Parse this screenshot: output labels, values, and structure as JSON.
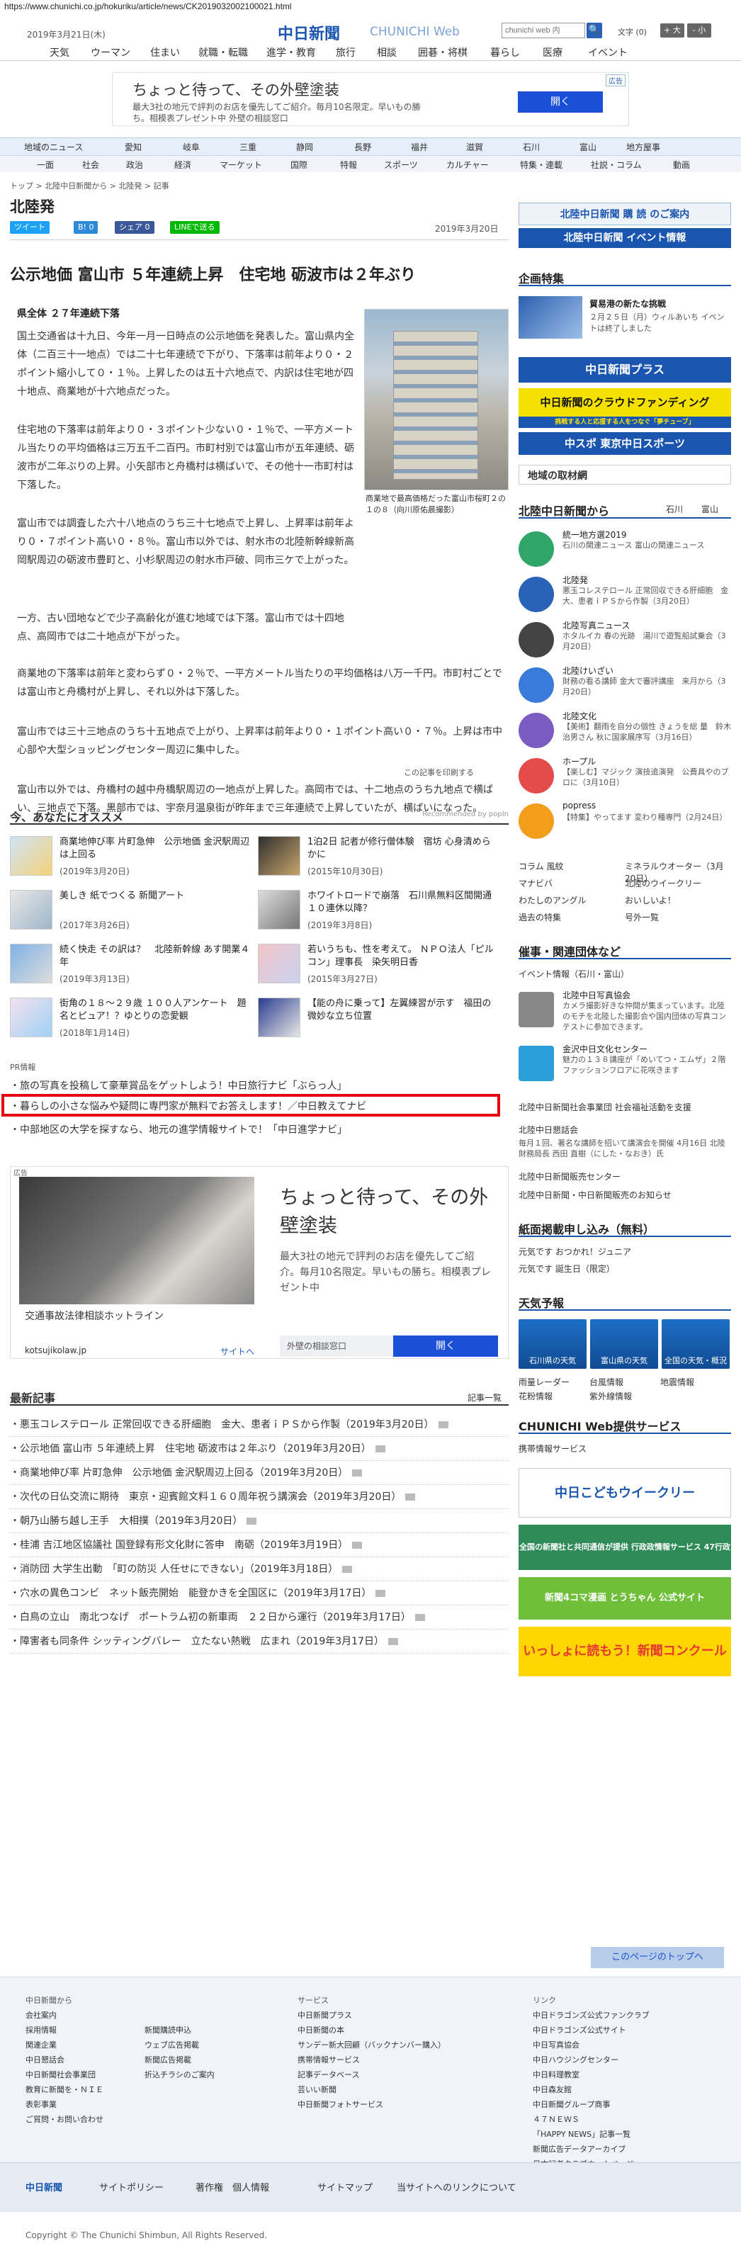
{
  "browser": {
    "url": "https://www.chunichi.co.jp/hokuriku/article/news/CK2019032002100021.html"
  },
  "header": {
    "date": "2019年3月21日(木)",
    "logo": "中日新聞",
    "logo_sub": "CHUNICHI Web",
    "search_placeholder": "chunichi web 内",
    "search_icon": "🔍",
    "font_label": "文字",
    "font_size": "(0)",
    "font_up": "+ 大",
    "font_down": "- 小"
  },
  "topnav": [
    "天気",
    "ウーマン",
    "住まい",
    "就職・転職",
    "進学・教育",
    "旅行",
    "相談",
    "囲碁・将棋",
    "暮らし",
    "医療",
    "イベント"
  ],
  "ad_top": {
    "title": "ちょっと待って、その外壁塗装",
    "body": "最大3社の地元で評判のお店を優先してご紹介。毎月10名限定。早いもの勝ち。相模表プレゼント中 外壁の相談窓口",
    "button": "開く",
    "tag": "広告"
  },
  "catnav1": [
    "地域のニュース",
    "愛知",
    "岐阜",
    "三重",
    "静岡",
    "長野",
    "福井",
    "滋賀",
    "石川",
    "富山",
    "地方屋事"
  ],
  "catnav2": [
    "一面",
    "社会",
    "政治",
    "経済",
    "マーケット",
    "国際",
    "特報",
    "スポーツ",
    "カルチャー",
    "特集・連載",
    "社説・コラム",
    "動画"
  ],
  "breadcrumb": "トップ > 北陸中日新聞から > 北陸発 > 記事",
  "section_title": "北陸発",
  "share": {
    "tweet": "ツイート",
    "hatena": "B! 0",
    "facebook": "シェア 0",
    "line": "LINEで送る"
  },
  "article": {
    "date": "2019年3月20日",
    "headline": "公示地価 富山市 ５年連続上昇　住宅地 砺波市は２年ぶり",
    "subhead": "県全体 ２７年連続下落",
    "p1": "国土交通省は十九日、今年一月一日時点の公示地価を発表した。富山県内全体（二百三十一地点）では二十七年連続で下がり、下落率は前年より０・２ポイント縮小して０・１％。上昇したのは五十六地点で、内訳は住宅地が四十地点、商業地が十六地点だった。",
    "p2": "住宅地の下落率は前年より０・３ポイント少ない０・１％で、一平方メートル当たりの平均価格は三万五千二百円。市町村別では富山市が五年連続、砺波市が二年ぶりの上昇。小矢部市と舟橋村は横ばいで、その他十一市町村は下落した。",
    "p3": "富山市では調査した六十八地点のうち三十七地点で上昇し、上昇率は前年より０・７ポイント高い０・８％。富山市以外では、射水市の北陸新幹線新高岡駅周辺の砺波市豊町と、小杉駅周辺の射水市戸破、同市三ケで上がった。",
    "p4": "一方、古い団地などで少子高齢化が進む地域では下落。富山市では十四地点、高岡市では二十地点が下がった。",
    "p5": "商業地の下落率は前年と変わらず０・２％で、一平方メートル当たりの平均価格は八万一千円。市町村ごとでは富山市と舟橋村が上昇し、それ以外は下落した。",
    "p6": "富山市では三十三地点のうち十五地点で上がり、上昇率は前年より０・１ポイント高い０・７％。上昇は市中心部や大型ショッピングセンター周辺に集中した。",
    "p7": "富山市以外では、舟橋村の越中舟橋駅周辺の一地点が上昇した。高岡市では、十二地点のうち九地点で横ばい、三地点で下落。黒部市では、宇奈月温泉街が昨年まで三年連続で上昇していたが、横ばいになった。",
    "photo_caption": "商業地で最高価格だった富山市桜町２の１の８（向川原佑晨撮影）",
    "print": "この記事を印刷する"
  },
  "recommend": {
    "title": "今、あなたにオススメ",
    "powered": "Recommended by popIn",
    "items": [
      {
        "title": "商業地伸び率 片町急伸　公示地価 金沢駅周辺は上回る",
        "date": "(2019年3月20日)"
      },
      {
        "title": "1泊2日 記者が修行僧体験　宿坊 心身清めらかに",
        "date": "(2015年10月30日)"
      },
      {
        "title": "美しき 紙でつくる 新聞アート",
        "date": "(2017年3月26日)"
      },
      {
        "title": "ホワイトロードで崩落　石川県無料区間開通１０連休以降？",
        "date": "(2019年3月8日)"
      },
      {
        "title": "続く快走 その訳は？　北陸新幹線 あす開業４年",
        "date": "(2019年3月13日)"
      },
      {
        "title": "若いうちも、性を考えて。 ＮＰＯ法人「ピルコン」理事長　染矢明日香",
        "date": "(2015年3月27日)"
      },
      {
        "title": "街角の１８～２９歳 １００人アンケート　題名とピュア！？ゆとりの恋愛観",
        "date": "(2018年1月14日)"
      },
      {
        "title": "【能の舟に乗って】左翼練習が示す　福田の微妙な立ち位置",
        "date": ""
      }
    ]
  },
  "pr": {
    "label": "PR情報",
    "lines": [
      "旅の写真を投稿して豪華賞品をゲットしよう！中日旅行ナビ「ぶらっ人」",
      "暮らしの小さな悩みや疑問に専門家が無料でお答えします！／中日教えてナビ",
      "中部地区の大学を探すなら、地元の進学情報サイトで！「中日進学ナビ」"
    ]
  },
  "ad_big": {
    "tag": "広告",
    "caption": "交通事故法律相談ホットライン",
    "logo": "kotsujikolaw.jp",
    "site": "サイトへ",
    "title": "ちょっと待って、その外壁塗装",
    "body": "最大3社の地元で評判のお店を優先してご紹介。毎月10名限定。早いもの勝ち。相模表プレゼント中",
    "label": "外壁の相談窓口",
    "button": "開く"
  },
  "latest": {
    "title": "最新記事",
    "more": "記事一覧",
    "items": [
      "悪玉コレステロール 正常回収できる肝細胞　金大、患者ｉＰＳから作製（2019年3月20日）",
      "公示地価 富山市 ５年連続上昇　住宅地 砺波市は２年ぶり（2019年3月20日）",
      "商業地伸び率 片町急伸　公示地価 金沢駅周辺上回る（2019年3月20日）",
      "次代の日仏交流に期待　東京・迎賓館文料１６０周年祝う講演会（2019年3月20日）",
      "朝乃山勝ち越し王手　大相撲（2019年3月20日）",
      "桂浦 吉江地区協議社 国登録有形文化財に答申　南砺（2019年3月19日）",
      "消防団 大学生出動　「町の防災 人任せにできない」（2019年3月18日）",
      "穴水の異色コンビ　ネット飯売開始　能登かきを全国区に（2019年3月17日）",
      "白鳥の立山　南北つなげ　ポートラム初の新車両　２２日から運行（2019年3月17日）",
      "障害者も同条件 シッティングバレー　立たない熱戦　広まれ（2019年3月17日）"
    ]
  },
  "right": {
    "subscribe": "北陸中日新聞 購 読 のご案内",
    "event_info": "北陸中日新聞 イベント情報",
    "kikaku": "企画特集",
    "kikaku_item_title": "貿易港の新たな挑戦",
    "kikaku_item_body": "２月２５日（月）ウィルあいち イベントは終了しました",
    "banner_plus": "中日新聞プラス",
    "banner_cf": "中日新聞のクラウドファンディング",
    "banner_cf_sub": "挑戦する人と応援する人をつなぐ「夢チューブ」",
    "banner_sports": "中スポ 東京中日スポーツ",
    "local": "地域の取材網",
    "from": "北陸中日新聞から",
    "from_tabs": [
      "石川",
      "富山"
    ],
    "side_items": [
      {
        "t": "統一地方選2019",
        "d": "石川の関連ニュース 富山の関連ニュース"
      },
      {
        "t": "北陸発",
        "d": "悪玉コレステロール 正常回収できる肝細胞　金大、患者ｉＰＳから作製（3月20日）"
      },
      {
        "t": "北陸写真ニュース",
        "d": "ホタルイカ 春の光跡　湯川で遊覧船試乗会（3月20日）"
      },
      {
        "t": "北陸けいざい",
        "d": "財務の看る講師 金大で審評講座　来月から（3月20日）"
      },
      {
        "t": "北陸文化",
        "d": "【美術】翻雨を自分の個性 きょうを総 量　鈴木治男さん 秋に国家展序写（3月16日）"
      },
      {
        "t": "ホープル",
        "d": "【楽しむ】マジック 演技追演発　公費具やのブロに（3月10日）"
      },
      {
        "t": "popress",
        "d": "【特集】やってます 変わり種専門（2月24日）"
      }
    ],
    "links": [
      "コラム 風紋",
      "ミネラルウオーター（3月20日）",
      "マナビバ",
      "北陸のウイークリー",
      "わたしのアングル",
      "おいしいよ！",
      "過去の特集",
      "号外一覧"
    ],
    "event": "催事・関連団体など",
    "event_sub": "イベント情報（石川・富山）",
    "org_items": [
      {
        "t": "北陸中日写真協会",
        "d": "カメラ撮影好きな仲間が集まっています。北陸のモチを北陸した撮影会や国内団体の写真コンテストに参加できます。"
      },
      {
        "t": "金沢中日文化センター",
        "d": "魅力の１３８講座が「めいてつ・エムザ」２階ファッションフロアに花咲きます"
      }
    ],
    "org_links": [
      "北陸中日新聞社会事業団 社会福祉活動を支援",
      "北陸中日懇話会",
      "毎月１回、著名な講師を招いて講演会を開催 4月16日 北陸財務局長 西田 直樹（にした・なおき）氏",
      "北陸中日新聞販売センター",
      "北陸中日新聞・中日新聞販売のお知らせ"
    ],
    "paper": "紙面掲載申し込み（無料）",
    "paper_links": [
      "元気です おつかれ！ジュニア",
      "元気です 誕生日（限定）"
    ],
    "weather": "天気予報",
    "weather_items": [
      "石川県の天気",
      "富山県の天気",
      "全国の天気・概況"
    ],
    "weather_links": [
      "雨量レーダー",
      "台風情報",
      "地震情報",
      "花粉情報",
      "紫外線情報"
    ],
    "service": "CHUNICHI Web提供サービス",
    "service_link": "携帯情報サービス",
    "ad_kodomo": "中日こどもウイークリー",
    "ad_gyosei": "全国の新聞社と共同通信が提供 行政政情報サービス 47行政ジャーナル",
    "ad_shinbun": "新聞4コマ漫画 とうちゃん 公式サイト",
    "ad_nie": "いっしょに読もう！新聞コンクール"
  },
  "toplink": "このページのトップへ",
  "footer": {
    "col1": [
      "中日新聞から",
      "会社案内",
      "採用情報",
      "関連企業",
      "中日懇話会",
      "中日新聞社会事業団",
      "教育に新聞を・ＮＩＥ",
      "表彰事業",
      "ご質問・お問い合わせ"
    ],
    "col2": [
      "新聞購読申込",
      "ウェブ広告掲載",
      "新聞広告掲載",
      "折込チラシのご案内"
    ],
    "col3": [
      "サービス",
      "中日新聞プラス",
      "中日新聞の本",
      "サンデー新大回顧（バックナンバー購入）",
      "携帯情報サービス",
      "記事データベース",
      "芸いい新聞",
      "中日新聞フォトサービス"
    ],
    "col4": [
      "リンク",
      "中日ドラゴンズ公式ファンクラブ",
      "中日ドラゴンズ公式サイト",
      "中日写真協会",
      "中日ハウジングセンター",
      "中日料理教室",
      "中日森友館",
      "中日新聞グループ商事",
      "４７ＮＥＷＳ",
      "「HAPPY NEWS」記事一覧",
      "新聞広告データアーカイブ",
      "日本記者クラブホームページ"
    ],
    "bottom": [
      "中日新聞",
      "サイトポリシー",
      "著作権",
      "個人情報",
      "サイトマップ",
      "当サイトへのリンクについて"
    ],
    "copyright": "Copyright © The Chunichi Shimbun, All Rights Reserved."
  }
}
